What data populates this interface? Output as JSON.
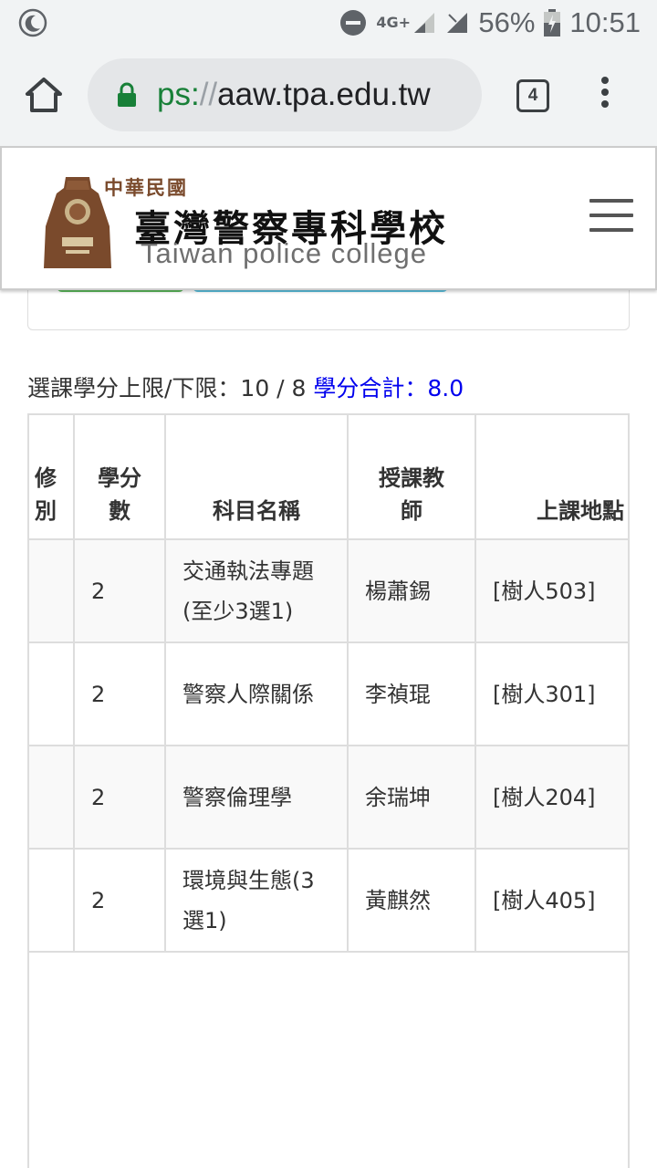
{
  "status_bar": {
    "network": "4G+",
    "battery_pct": "56%",
    "time": "10:51"
  },
  "browser": {
    "url_scheme": "ps:",
    "url_slashes": "//",
    "url_host": "aaw.tpa.edu.tw",
    "tab_count": "4"
  },
  "site": {
    "logo_small": "中華民國",
    "logo_main": "臺灣警察專科學校",
    "logo_en": "Taiwan police college"
  },
  "credits": {
    "limits_text": "選課學分上限/下限：10 / 8 ",
    "total_text": "學分合計：8.0"
  },
  "table": {
    "headers": {
      "type_line1": "修",
      "type_line2": "別",
      "credits_line1": "學分",
      "credits_line2": "數",
      "subject": "科目名稱",
      "teacher_line1": "授課教",
      "teacher_line2": "師",
      "room": "上課地點"
    },
    "rows": [
      {
        "credits": "2",
        "subject": "交通執法專題(至少3選1)",
        "teacher": "楊蕭錫",
        "room": "[樹人503]"
      },
      {
        "credits": "2",
        "subject": "警察人際關係",
        "teacher": "李禎琨",
        "room": "[樹人301]"
      },
      {
        "credits": "2",
        "subject": "警察倫理學",
        "teacher": "余瑞坤",
        "room": "[樹人204]"
      },
      {
        "credits": "2",
        "subject": "環境與生態(3選1)",
        "teacher": "黃麒然",
        "room": "[樹人405]"
      }
    ]
  },
  "colors": {
    "link_blue": "#0000ee",
    "lock_green": "#188038",
    "button_green": "#5cb85c",
    "button_blue": "#5bc0de",
    "emblem_brown": "#7a4a2c"
  },
  "icons": [
    "moon-icon",
    "do-not-disturb-icon",
    "signal-icon",
    "battery-icon",
    "home-icon",
    "lock-icon",
    "tab-switcher-icon",
    "overflow-menu-icon",
    "hamburger-menu-icon",
    "emblem-logo"
  ]
}
